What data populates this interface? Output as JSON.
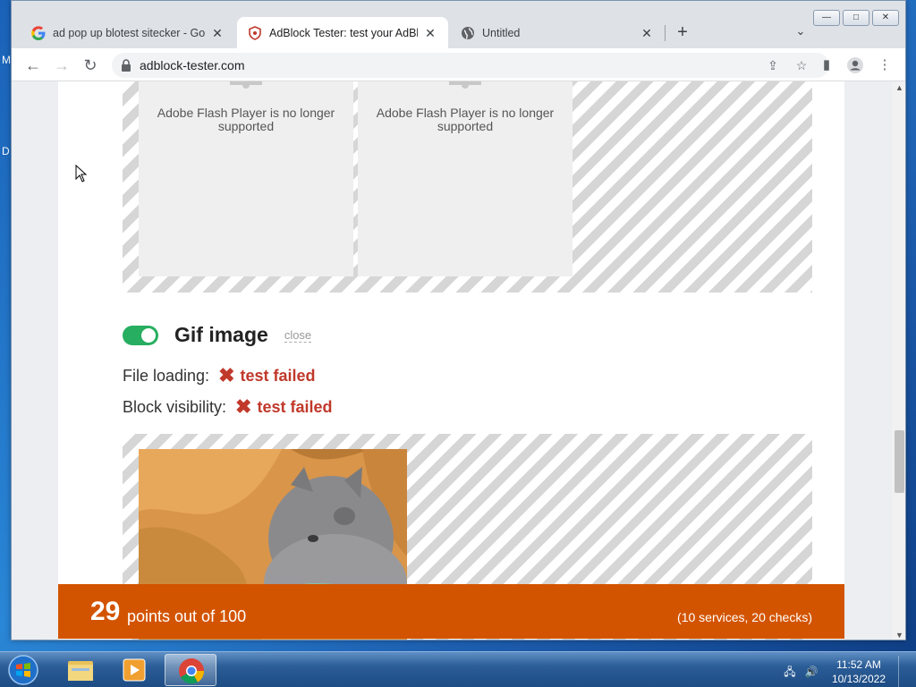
{
  "desktop": {
    "letters": [
      "M",
      "D"
    ]
  },
  "browser": {
    "tabs": [
      {
        "title": "ad pop up blotest sitecker - Goo",
        "icon": "google-icon",
        "active": false
      },
      {
        "title": "AdBlock Tester: test your AdBlock",
        "icon": "adblock-tester-icon",
        "active": true
      },
      {
        "title": "Untitled",
        "icon": "globe-icon",
        "active": false
      }
    ],
    "new_tab_label": "+",
    "url": "adblock-tester.com",
    "window_controls": {
      "minimize": "—",
      "maximize": "□",
      "close": "✕"
    }
  },
  "page": {
    "flash_message": "Adobe Flash Player is no longer supported",
    "section": {
      "title": "Gif image",
      "close_label": "close",
      "toggle_on": true
    },
    "checks": [
      {
        "label": "File loading:",
        "result": "test failed"
      },
      {
        "label": "Block visibility:",
        "result": "test failed"
      }
    ],
    "score": {
      "points": "29",
      "text": "points out of 100",
      "detail": "(10 services, 20 checks)"
    }
  },
  "taskbar": {
    "clock_time": "11:52 AM",
    "clock_date": "10/13/2022",
    "items": [
      "windows-explorer",
      "media-player",
      "chrome"
    ]
  },
  "colors": {
    "accent_orange": "#d35400",
    "fail_red": "#c0392b",
    "toggle_green": "#27ae60"
  }
}
